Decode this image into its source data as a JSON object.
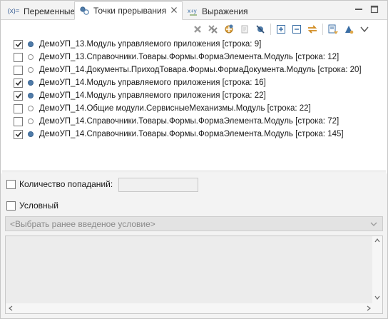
{
  "tabs": [
    {
      "label": "Переменные",
      "icon": "variables-icon",
      "active": false
    },
    {
      "label": "Точки прерывания",
      "icon": "breakpoints-icon",
      "active": true,
      "closable": true
    },
    {
      "label": "Выражения",
      "icon": "expressions-icon",
      "active": false
    }
  ],
  "variables_icon_text": "(x)=",
  "toolbar_icons": [
    "remove-breakpoint-icon",
    "remove-all-breakpoints-icon",
    "show-breakpoints-target-icon",
    "go-to-file-icon",
    "skip-all-breakpoints-icon",
    "expand-all-icon",
    "collapse-all-icon",
    "link-with-debug-view-icon",
    "add-java-exception-icon",
    "view-menu-icon",
    "view-menu-chevron-icon"
  ],
  "breakpoints": [
    {
      "checked": true,
      "enabled_dot": true,
      "text": "ДемоУП_13.Модуль управляемого приложения [строка: 9]"
    },
    {
      "checked": false,
      "enabled_dot": false,
      "text": "ДемоУП_13.Справочники.Товары.Формы.ФормаЭлемента.Модуль [строка: 12]"
    },
    {
      "checked": false,
      "enabled_dot": false,
      "text": "ДемоУП_14.Документы.ПриходТовара.Формы.ФормаДокумента.Модуль [строка: 20]"
    },
    {
      "checked": true,
      "enabled_dot": true,
      "text": "ДемоУП_14.Модуль управляемого приложения [строка: 16]"
    },
    {
      "checked": true,
      "enabled_dot": true,
      "text": "ДемоУП_14.Модуль управляемого приложения [строка: 22]"
    },
    {
      "checked": false,
      "enabled_dot": false,
      "text": "ДемоУП_14.Общие модули.СервисныеМеханизмы.Модуль [строка: 22]"
    },
    {
      "checked": false,
      "enabled_dot": false,
      "text": "ДемоУП_14.Справочники.Товары.Формы.ФормаЭлемента.Модуль [строка: 72]"
    },
    {
      "checked": true,
      "enabled_dot": true,
      "text": "ДемоУП_14.Справочники.Товары.Формы.ФормаЭлемента.Модуль [строка: 145]"
    }
  ],
  "hit_count": {
    "label": "Количество попаданий:",
    "checked": false,
    "value": ""
  },
  "conditional": {
    "label": "Условный",
    "checked": false
  },
  "condition_combo": {
    "placeholder": "<Выбрать ранее введеное условие>"
  },
  "condition_editor": {
    "value": ""
  },
  "colors": {
    "accent_dot": "#4f7ba8",
    "tab_bg": "#f3f3f3",
    "panel_bg": "#f3f3f3"
  }
}
